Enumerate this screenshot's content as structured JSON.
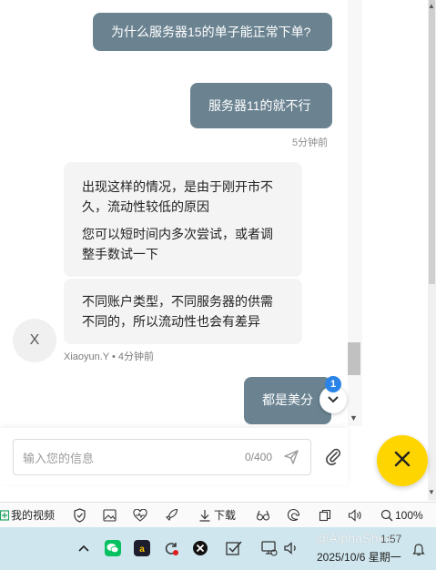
{
  "chat": {
    "messages_out": [
      {
        "text": "为什么服务器15的单子能正常下单?"
      },
      {
        "text": "服务器11的就不行"
      }
    ],
    "out_time": "5分钟前",
    "messages_in": [
      {
        "p1": "出现这样的情况，是由于刚开市不久，流动性较低的原因",
        "p2": "您可以短时间内多次尝试，或者调整手数试一下"
      },
      {
        "p1": "不同账户类型，不同服务器的供需不同的，所以流动性也会有差异"
      }
    ],
    "agent_avatar": "X",
    "agent_meta": "Xiaoyun.Y • 4分钟前",
    "last_out": "都是美分",
    "unread_badge": "1"
  },
  "input": {
    "placeholder": "输入您的信息",
    "value": "",
    "counter": "0/400"
  },
  "browser_bar": {
    "my_videos": "我的视频",
    "download": "下载",
    "zoom": "100%"
  },
  "taskbar": {
    "time": "1:57",
    "date": "2025/10/6 星期一",
    "watermark": "@AlphaShen"
  },
  "colors": {
    "outgoing_bubble": "#6b8391",
    "incoming_bubble": "#f4f4f4",
    "fab": "#ffd500",
    "badge": "#2a84e8",
    "taskbar": "#cfe6ee"
  },
  "icons": [
    "send-icon",
    "attach-icon",
    "close-icon",
    "chevron-down-icon",
    "shield-icon",
    "image-icon",
    "heart-rate-icon",
    "rocket-icon",
    "download-icon",
    "glasses-icon",
    "edge-icon",
    "copy-icon",
    "speaker-icon",
    "zoom-icon",
    "chevron-up-icon",
    "wechat-icon",
    "wps-icon",
    "sync-icon",
    "xbox-icon",
    "checkbox-icon",
    "network-icon",
    "volume-icon",
    "notification-icon"
  ]
}
